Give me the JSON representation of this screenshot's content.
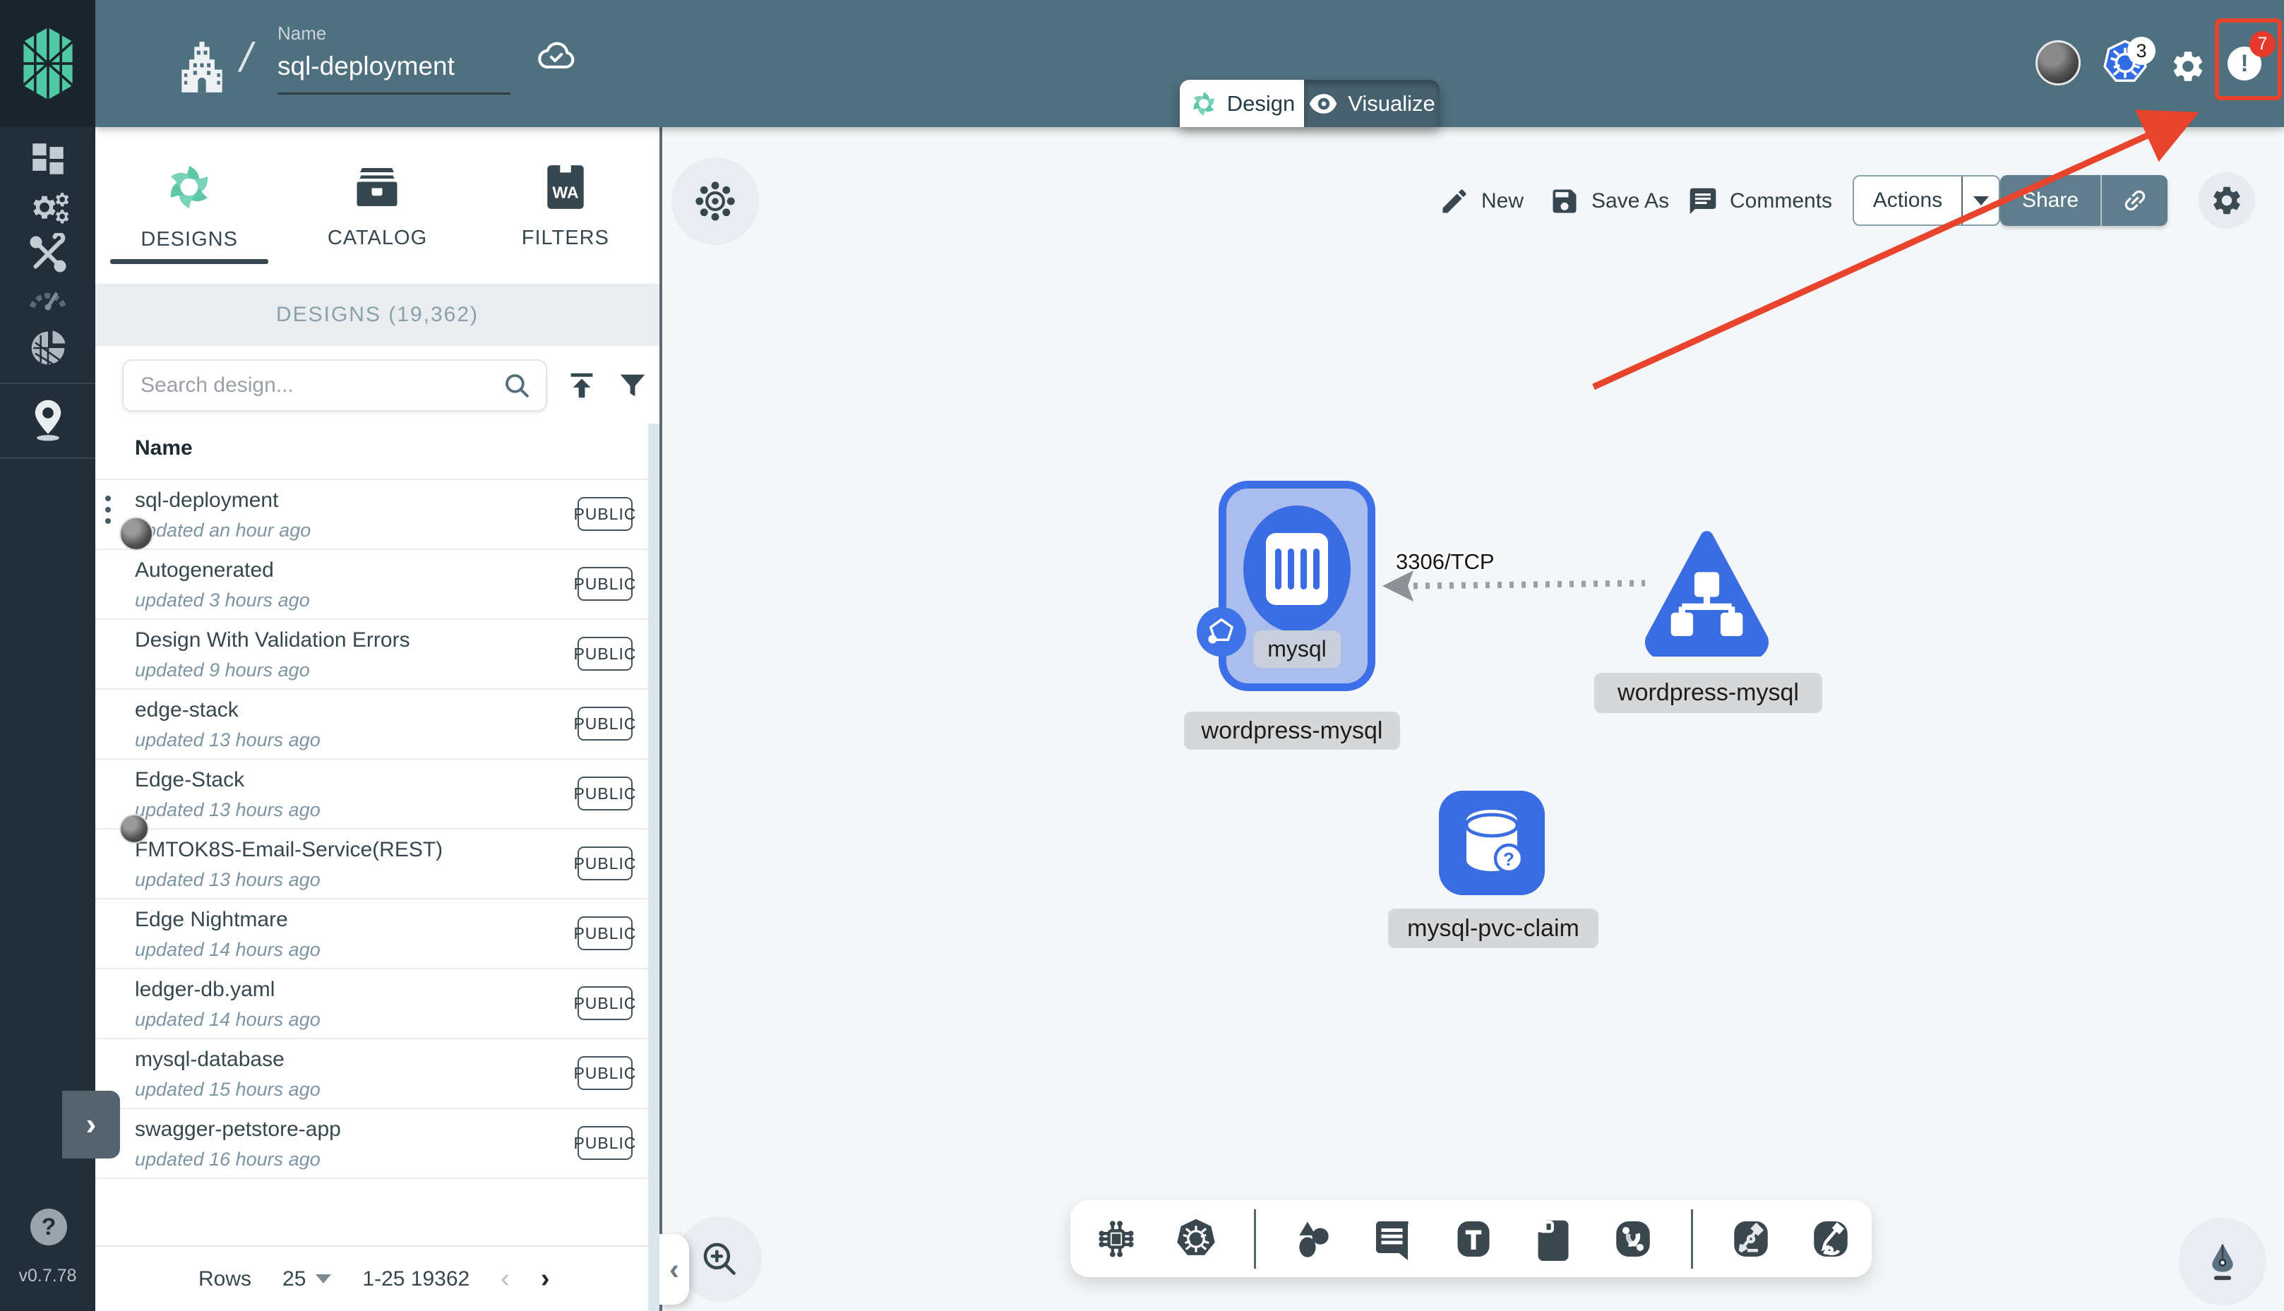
{
  "app": {
    "version": "v0.7.78"
  },
  "header": {
    "breadcrumb_label": "Name",
    "design_name": "sql-deployment",
    "kubernetes_context_badge": "3",
    "notification_badge": "7"
  },
  "view_toggle": {
    "design": "Design",
    "visualize": "Visualize"
  },
  "canvas_actions": {
    "new": "New",
    "save_as": "Save As",
    "comments": "Comments",
    "actions": "Actions",
    "share": "Share"
  },
  "sidebar_tabs": {
    "designs": "DESIGNS",
    "catalog": "CATALOG",
    "filters": "FILTERS",
    "filters_icon_text": "WA"
  },
  "designs_panel": {
    "section_title": "DESIGNS (19,362)",
    "search_placeholder": "Search design...",
    "table_header": "Name",
    "rows": [
      {
        "name": "sql-deployment",
        "updated": "updated an hour ago",
        "visibility": "PUBLIC"
      },
      {
        "name": "Autogenerated",
        "updated": "updated 3 hours ago",
        "visibility": "PUBLIC"
      },
      {
        "name": "Design With Validation Errors",
        "updated": "updated 9 hours ago",
        "visibility": "PUBLIC"
      },
      {
        "name": "edge-stack",
        "updated": "updated 13 hours ago",
        "visibility": "PUBLIC"
      },
      {
        "name": "Edge-Stack",
        "updated": "updated 13 hours ago",
        "visibility": "PUBLIC"
      },
      {
        "name": "FMTOK8S-Email-Service(REST)",
        "updated": "updated 13 hours ago",
        "visibility": "PUBLIC"
      },
      {
        "name": "Edge Nightmare",
        "updated": "updated 14 hours ago",
        "visibility": "PUBLIC"
      },
      {
        "name": "ledger-db.yaml",
        "updated": "updated 14 hours ago",
        "visibility": "PUBLIC"
      },
      {
        "name": "mysql-database",
        "updated": "updated 15 hours ago",
        "visibility": "PUBLIC"
      },
      {
        "name": "swagger-petstore-app",
        "updated": "updated 16 hours ago",
        "visibility": "PUBLIC"
      }
    ],
    "pagination": {
      "rows_label": "Rows",
      "page_size": "25",
      "range": "1-25 19362"
    }
  },
  "diagram": {
    "nodes": [
      {
        "id": "deployment",
        "inner_label": "mysql",
        "external_label": "wordpress-mysql"
      },
      {
        "id": "service",
        "external_label": "wordpress-mysql"
      },
      {
        "id": "persistent-volume-claim",
        "external_label": "mysql-pvc-claim"
      }
    ],
    "edge": {
      "label": "3306/TCP"
    }
  },
  "colors": {
    "header_teal": "#4f707e",
    "rail_dark": "#222f3a",
    "node_blue": "#3a6de2",
    "node_fill": "#aabdec",
    "annotation_red": "#e8432c",
    "badge_red": "#e53a2c",
    "brand_green": "#62c5a8",
    "share_slate": "#5f7d8c"
  }
}
